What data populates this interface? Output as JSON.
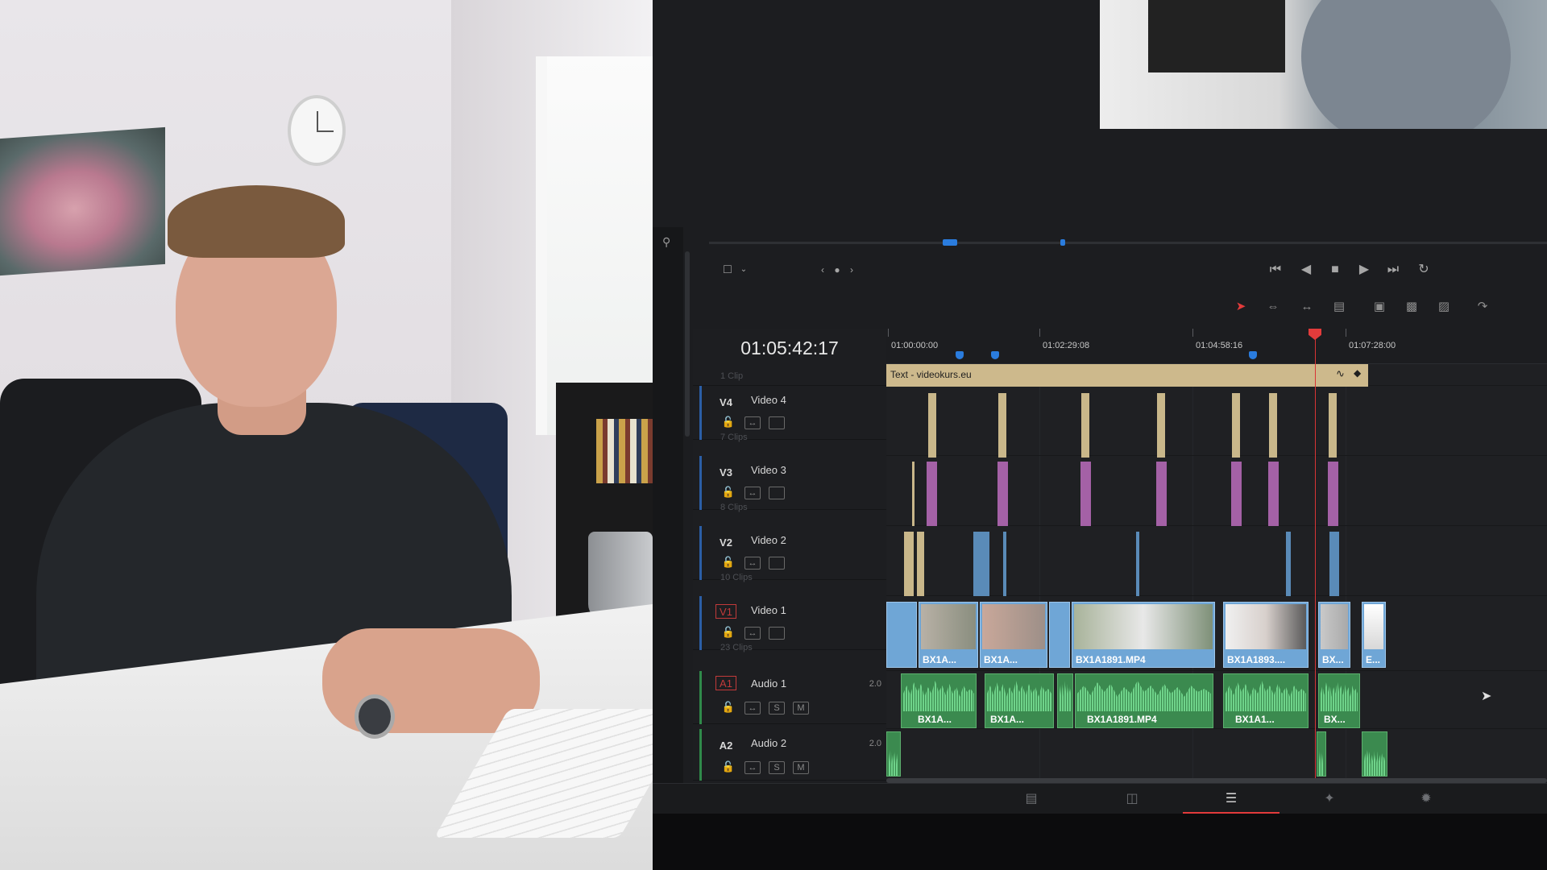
{
  "timeline": {
    "timecode": "01:05:42:17",
    "ruler_labels": [
      "01:00:00:00",
      "01:02:29:08",
      "01:04:58:16",
      "01:07:28:00"
    ],
    "tracks": [
      {
        "id": "V4",
        "name": "Video 4",
        "clips_label": "1 Clip"
      },
      {
        "id": "V3",
        "name": "Video 3",
        "clips_label": "7 Clips"
      },
      {
        "id": "V2",
        "name": "Video 2",
        "clips_label": "8 Clips"
      },
      {
        "id": "V1",
        "name": "Video 1",
        "clips_label": "10 Clips"
      },
      {
        "id": "A1",
        "name": "Audio 1",
        "clips_label": "23 Clips",
        "channels": "2.0"
      },
      {
        "id": "A2",
        "name": "Audio 2",
        "channels": "2.0"
      }
    ],
    "text_clip": "Text - videokurs.eu",
    "video_clip_labels": [
      "BX1A...",
      "BX1A...",
      "BX1A1891.MP4",
      "BX1A1893....",
      "BX...",
      "E..."
    ],
    "audio_clip_labels": [
      "BX1A...",
      "BX1A...",
      "BX1A1891.MP4",
      "BX1A1...",
      "BX..."
    ],
    "track_buttons": {
      "solo": "S",
      "mute": "M"
    }
  },
  "icons": {
    "search": "search-icon",
    "transport": [
      "skip-to-start-icon",
      "step-back-icon",
      "stop-icon",
      "play-icon",
      "skip-to-end-icon",
      "loop-icon"
    ],
    "edit_tools": [
      "selection-arrow-icon",
      "trim-icon",
      "dynamic-trim-icon",
      "blade-icon",
      "insert-clip-icon",
      "overwrite-clip-icon",
      "replace-clip-icon",
      "snapping-icon"
    ],
    "pages": [
      "media-page-icon",
      "cut-page-icon",
      "edit-page-icon",
      "fusion-page-icon",
      "color-page-icon"
    ]
  },
  "colors": {
    "playhead": "#e23b3b",
    "marker": "#2a7cde",
    "text_clip": "#cdb98c",
    "purple_clip": "#a461a6",
    "video_clip": "#6fa6d6",
    "audio_clip": "#3b8a4f"
  }
}
